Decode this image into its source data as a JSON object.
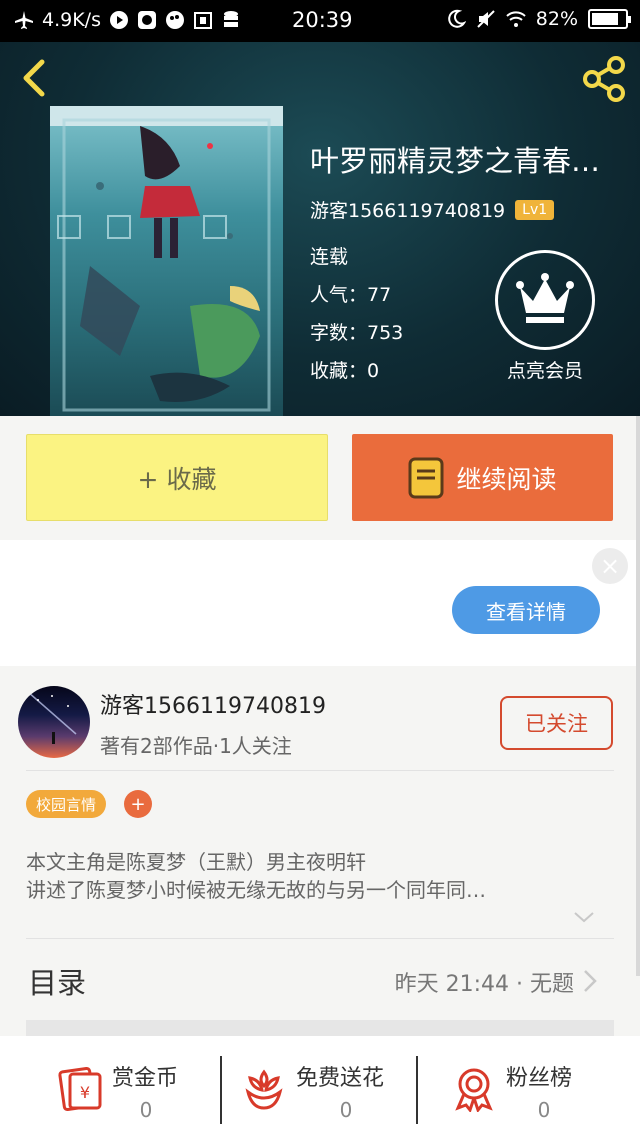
{
  "status_bar": {
    "speed": "4.9K/s",
    "time": "20:39",
    "battery": "82%",
    "battery_level": 0.82
  },
  "header": {
    "back_icon": "chevron-left-icon",
    "share_icon": "share-icon",
    "title": "叶罗丽精灵梦之青春…",
    "author": "游客1566119740819",
    "level": "Lv1",
    "status": "连载",
    "popularity": "人气：77",
    "word_count": "字数：753",
    "favorites": "收藏：0",
    "vip_label": "点亮会员",
    "vip_icon": "crown-icon"
  },
  "actions": {
    "favorite_label": "+ 收藏",
    "read_label": "继续阅读",
    "read_icon": "book-icon"
  },
  "ad": {
    "close_label": "×",
    "detail_label": "查看详情"
  },
  "author_section": {
    "name": "游客1566119740819",
    "subtitle": "著有2部作品·1人关注",
    "follow_label": "已关注",
    "tag": "校园言情",
    "tag_add": "+",
    "description_line1": "本文主角是陈夏梦（王默）男主夜明轩",
    "description_line2": "讲述了陈夏梦小时候被无缘无故的与另一个同年同…",
    "toc_label": "目录",
    "toc_latest": "昨天 21:44 · 无题"
  },
  "tools": [
    {
      "label": "赏金币",
      "count": "0",
      "icon": "red-envelope-icon"
    },
    {
      "label": "免费送花",
      "count": "0",
      "icon": "flower-icon"
    },
    {
      "label": "粉丝榜",
      "count": "0",
      "icon": "medal-icon"
    }
  ],
  "colors": {
    "accent_orange": "#ea6c3c",
    "favorite_yellow": "#fbf382",
    "follow_red": "#d44a2e",
    "detail_blue": "#4e9ae5",
    "tag_orange": "#f2a93b"
  }
}
